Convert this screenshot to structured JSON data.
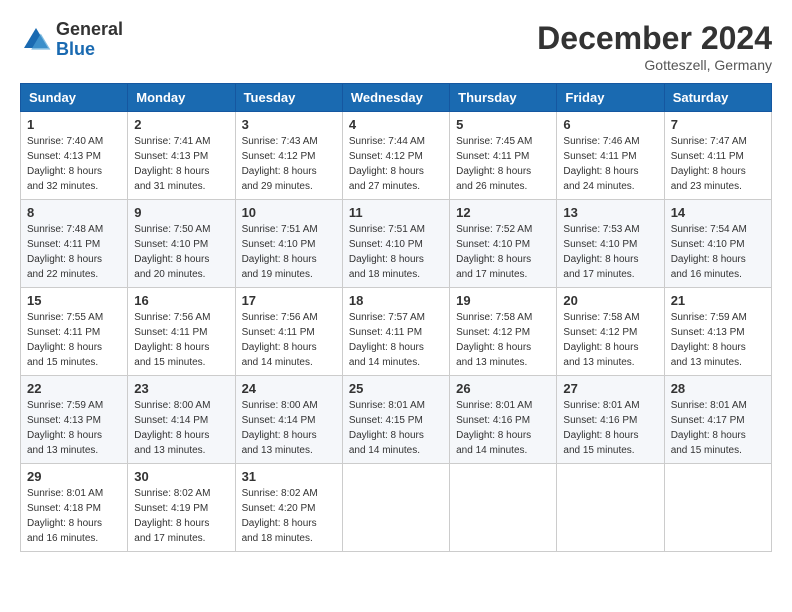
{
  "header": {
    "logo_text_general": "General",
    "logo_text_blue": "Blue",
    "month_title": "December 2024",
    "location": "Gotteszell, Germany"
  },
  "weekdays": [
    "Sunday",
    "Monday",
    "Tuesday",
    "Wednesday",
    "Thursday",
    "Friday",
    "Saturday"
  ],
  "weeks": [
    [
      {
        "day": "1",
        "sunrise": "7:40 AM",
        "sunset": "4:13 PM",
        "daylight": "8 hours and 32 minutes."
      },
      {
        "day": "2",
        "sunrise": "7:41 AM",
        "sunset": "4:13 PM",
        "daylight": "8 hours and 31 minutes."
      },
      {
        "day": "3",
        "sunrise": "7:43 AM",
        "sunset": "4:12 PM",
        "daylight": "8 hours and 29 minutes."
      },
      {
        "day": "4",
        "sunrise": "7:44 AM",
        "sunset": "4:12 PM",
        "daylight": "8 hours and 27 minutes."
      },
      {
        "day": "5",
        "sunrise": "7:45 AM",
        "sunset": "4:11 PM",
        "daylight": "8 hours and 26 minutes."
      },
      {
        "day": "6",
        "sunrise": "7:46 AM",
        "sunset": "4:11 PM",
        "daylight": "8 hours and 24 minutes."
      },
      {
        "day": "7",
        "sunrise": "7:47 AM",
        "sunset": "4:11 PM",
        "daylight": "8 hours and 23 minutes."
      }
    ],
    [
      {
        "day": "8",
        "sunrise": "7:48 AM",
        "sunset": "4:11 PM",
        "daylight": "8 hours and 22 minutes."
      },
      {
        "day": "9",
        "sunrise": "7:50 AM",
        "sunset": "4:10 PM",
        "daylight": "8 hours and 20 minutes."
      },
      {
        "day": "10",
        "sunrise": "7:51 AM",
        "sunset": "4:10 PM",
        "daylight": "8 hours and 19 minutes."
      },
      {
        "day": "11",
        "sunrise": "7:51 AM",
        "sunset": "4:10 PM",
        "daylight": "8 hours and 18 minutes."
      },
      {
        "day": "12",
        "sunrise": "7:52 AM",
        "sunset": "4:10 PM",
        "daylight": "8 hours and 17 minutes."
      },
      {
        "day": "13",
        "sunrise": "7:53 AM",
        "sunset": "4:10 PM",
        "daylight": "8 hours and 17 minutes."
      },
      {
        "day": "14",
        "sunrise": "7:54 AM",
        "sunset": "4:10 PM",
        "daylight": "8 hours and 16 minutes."
      }
    ],
    [
      {
        "day": "15",
        "sunrise": "7:55 AM",
        "sunset": "4:11 PM",
        "daylight": "8 hours and 15 minutes."
      },
      {
        "day": "16",
        "sunrise": "7:56 AM",
        "sunset": "4:11 PM",
        "daylight": "8 hours and 15 minutes."
      },
      {
        "day": "17",
        "sunrise": "7:56 AM",
        "sunset": "4:11 PM",
        "daylight": "8 hours and 14 minutes."
      },
      {
        "day": "18",
        "sunrise": "7:57 AM",
        "sunset": "4:11 PM",
        "daylight": "8 hours and 14 minutes."
      },
      {
        "day": "19",
        "sunrise": "7:58 AM",
        "sunset": "4:12 PM",
        "daylight": "8 hours and 13 minutes."
      },
      {
        "day": "20",
        "sunrise": "7:58 AM",
        "sunset": "4:12 PM",
        "daylight": "8 hours and 13 minutes."
      },
      {
        "day": "21",
        "sunrise": "7:59 AM",
        "sunset": "4:13 PM",
        "daylight": "8 hours and 13 minutes."
      }
    ],
    [
      {
        "day": "22",
        "sunrise": "7:59 AM",
        "sunset": "4:13 PM",
        "daylight": "8 hours and 13 minutes."
      },
      {
        "day": "23",
        "sunrise": "8:00 AM",
        "sunset": "4:14 PM",
        "daylight": "8 hours and 13 minutes."
      },
      {
        "day": "24",
        "sunrise": "8:00 AM",
        "sunset": "4:14 PM",
        "daylight": "8 hours and 13 minutes."
      },
      {
        "day": "25",
        "sunrise": "8:01 AM",
        "sunset": "4:15 PM",
        "daylight": "8 hours and 14 minutes."
      },
      {
        "day": "26",
        "sunrise": "8:01 AM",
        "sunset": "4:16 PM",
        "daylight": "8 hours and 14 minutes."
      },
      {
        "day": "27",
        "sunrise": "8:01 AM",
        "sunset": "4:16 PM",
        "daylight": "8 hours and 15 minutes."
      },
      {
        "day": "28",
        "sunrise": "8:01 AM",
        "sunset": "4:17 PM",
        "daylight": "8 hours and 15 minutes."
      }
    ],
    [
      {
        "day": "29",
        "sunrise": "8:01 AM",
        "sunset": "4:18 PM",
        "daylight": "8 hours and 16 minutes."
      },
      {
        "day": "30",
        "sunrise": "8:02 AM",
        "sunset": "4:19 PM",
        "daylight": "8 hours and 17 minutes."
      },
      {
        "day": "31",
        "sunrise": "8:02 AM",
        "sunset": "4:20 PM",
        "daylight": "8 hours and 18 minutes."
      },
      null,
      null,
      null,
      null
    ]
  ]
}
